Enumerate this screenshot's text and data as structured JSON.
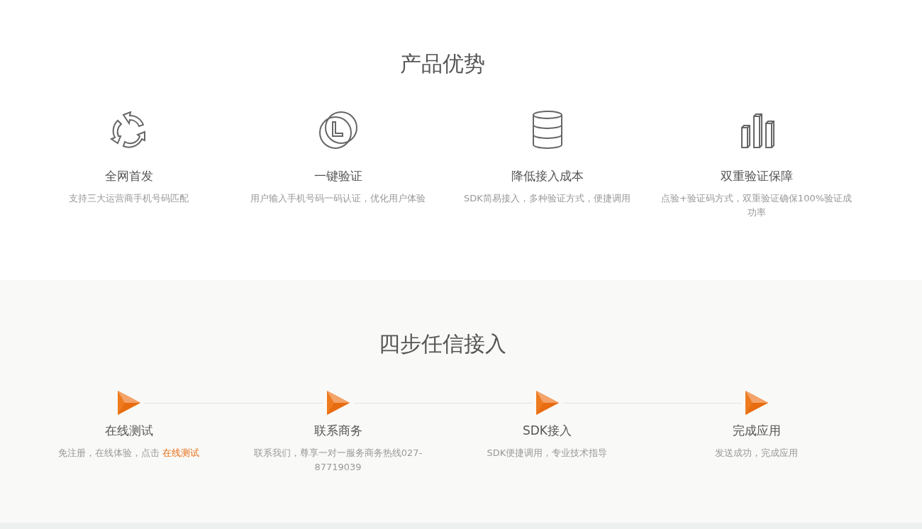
{
  "advantages": {
    "title": "产品优势",
    "items": [
      {
        "kind": "cycle",
        "title": "全网首发",
        "text": "支持三大运营商手机号码匹配"
      },
      {
        "kind": "clock",
        "title": "一键验证",
        "text": "用户输入手机号码一码认证，优化用户体验"
      },
      {
        "kind": "database",
        "title": "降低接入成本",
        "text": "SDK简易接入，多种验证方式，便捷调用"
      },
      {
        "kind": "bars",
        "title": "双重验证保障",
        "text": "点验+验证码方式，双重验证确保100%验证成功率"
      }
    ]
  },
  "steps": {
    "title": "四步任信接入",
    "items": [
      {
        "title": "在线测试",
        "text": "免注册，在线体验，点击 ",
        "link": "在线测试"
      },
      {
        "title": "联系商务",
        "text": "联系我们，尊享一对一服务商务热线027-87719039"
      },
      {
        "title": "SDK接入",
        "text": "SDK便捷调用，专业技术指导"
      },
      {
        "title": "完成应用",
        "text": "发送成功，完成应用"
      }
    ]
  }
}
